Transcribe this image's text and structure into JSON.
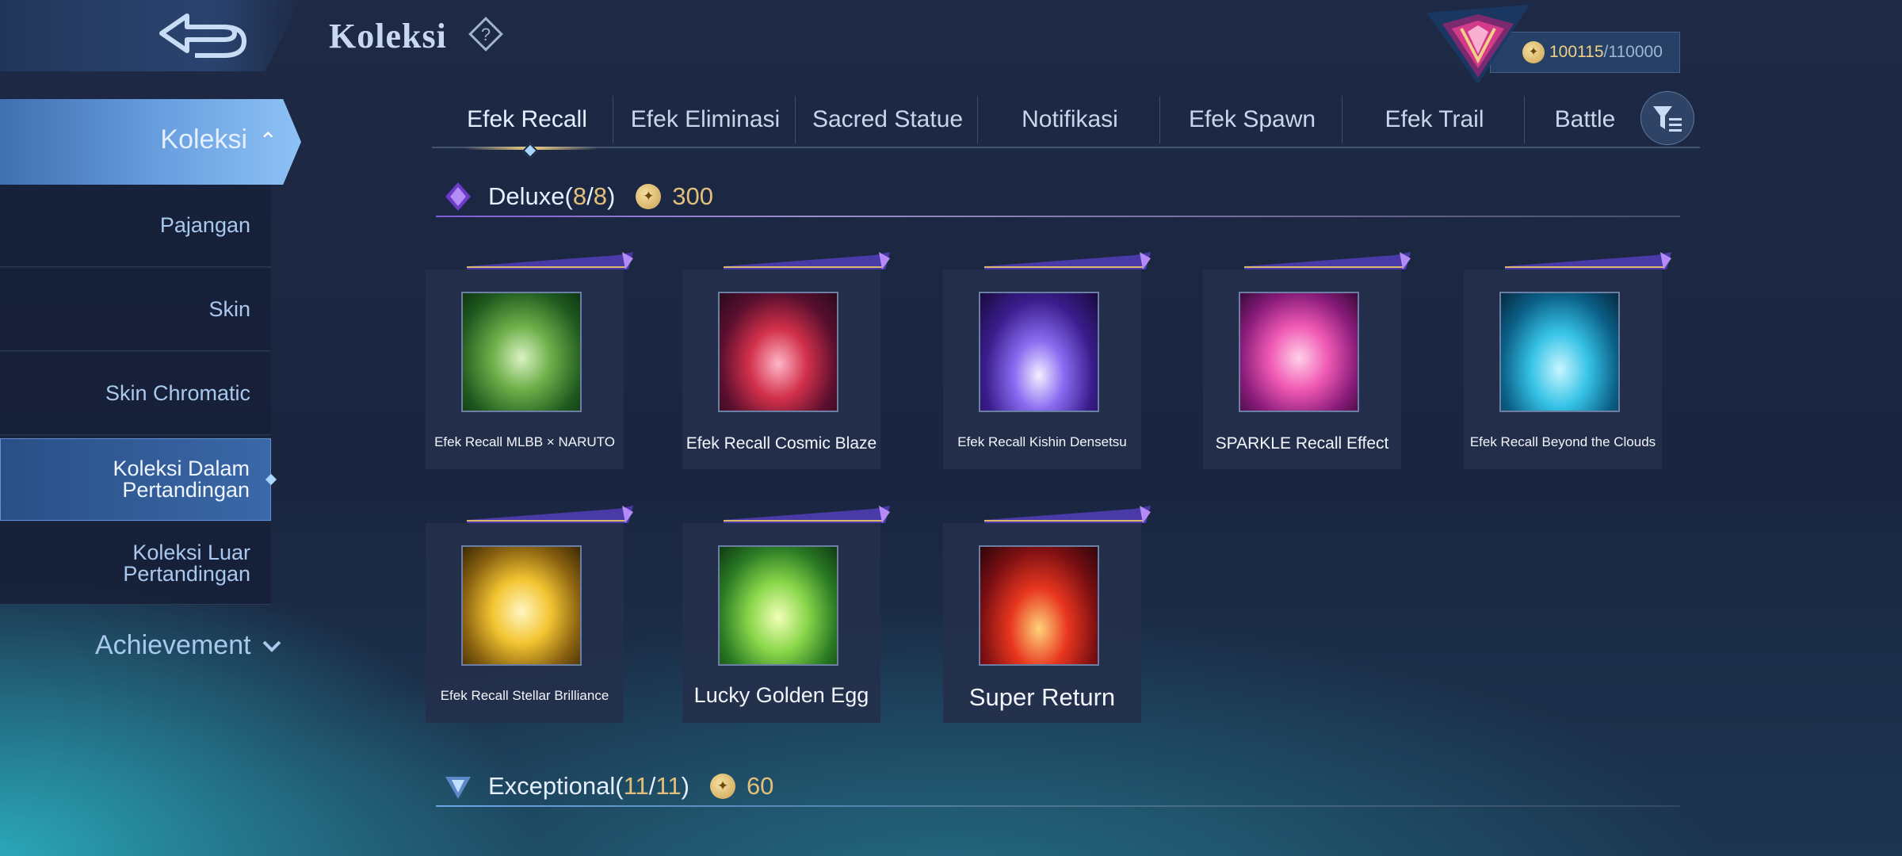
{
  "header": {
    "title": "Koleksi",
    "points_current": "100115",
    "points_separator": "/",
    "points_max": "110000"
  },
  "sidebar": {
    "active_group": "Koleksi",
    "items": [
      {
        "label": "Pajangan"
      },
      {
        "label": "Skin"
      },
      {
        "label": "Skin Chromatic"
      },
      {
        "label": "Koleksi Dalam Pertandingan",
        "line1": "Koleksi Dalam",
        "line2": "Pertandingan"
      },
      {
        "label": "Koleksi Luar Pertandingan",
        "line1": "Koleksi Luar",
        "line2": "Pertandingan"
      }
    ],
    "achievement": "Achievement"
  },
  "tabs": [
    "Efek Recall",
    "Efek Eliminasi",
    "Sacred Statue",
    "Notifikasi",
    "Efek Spawn",
    "Efek Trail",
    "Battle"
  ],
  "sections": {
    "deluxe": {
      "name": "Deluxe",
      "owned": "8",
      "total": "8",
      "price": "300"
    },
    "exceptional": {
      "name": "Exceptional",
      "owned": "11",
      "total": "11",
      "price": "60"
    }
  },
  "deluxe_items": [
    {
      "name": "Efek Recall MLBB × NARUTO"
    },
    {
      "name": "Efek Recall Cosmic Blaze"
    },
    {
      "name": "Efek Recall Kishin Densetsu"
    },
    {
      "name": "SPARKLE Recall Effect"
    },
    {
      "name": "Efek Recall Beyond the Clouds"
    },
    {
      "name": "Efek Recall Stellar Brilliance"
    },
    {
      "name": "Lucky Golden Egg"
    },
    {
      "name": "Super Return"
    }
  ],
  "colors": {
    "accent_gold": "#e3c07a",
    "sidebar_active": "#6aa0e0",
    "deluxe_purple": "#7e5ed8"
  },
  "icons": [
    "back-arrow-icon",
    "help-icon",
    "rank-emblem-icon",
    "coin-icon",
    "chevron-up-icon",
    "chevron-down-icon",
    "filter-icon",
    "deluxe-gem-icon",
    "exceptional-gem-icon"
  ]
}
